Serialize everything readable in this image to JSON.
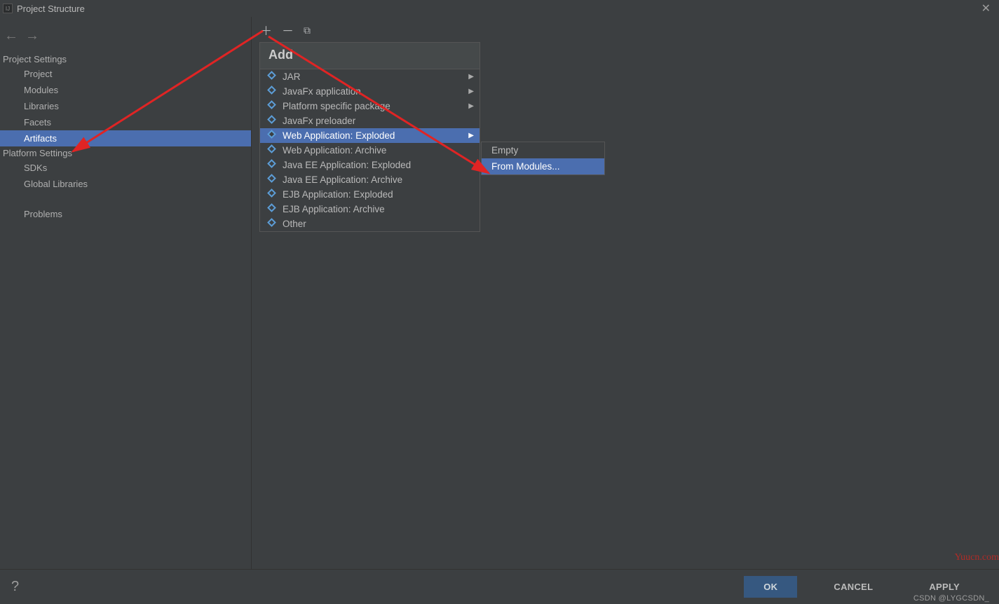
{
  "window": {
    "title": "Project Structure"
  },
  "sidebar": {
    "group1_label": "Project Settings",
    "items1": {
      "0": {
        "label": "Project"
      },
      "1": {
        "label": "Modules"
      },
      "2": {
        "label": "Libraries"
      },
      "3": {
        "label": "Facets"
      },
      "4": {
        "label": "Artifacts",
        "selected": true
      }
    },
    "group2_label": "Platform Settings",
    "items2": {
      "0": {
        "label": "SDKs"
      },
      "1": {
        "label": "Global Libraries"
      }
    },
    "extra": {
      "0": {
        "label": "Problems"
      }
    }
  },
  "popup_add": {
    "header": "Add",
    "items": {
      "0": {
        "label": "JAR",
        "has_sub": true
      },
      "1": {
        "label": "JavaFx application",
        "has_sub": true
      },
      "2": {
        "label": "Platform specific package",
        "has_sub": true
      },
      "3": {
        "label": "JavaFx preloader",
        "has_sub": false
      },
      "4": {
        "label": "Web Application: Exploded",
        "has_sub": true,
        "selected": true
      },
      "5": {
        "label": "Web Application: Archive",
        "has_sub": false
      },
      "6": {
        "label": "Java EE Application: Exploded",
        "has_sub": false
      },
      "7": {
        "label": "Java EE Application: Archive",
        "has_sub": false
      },
      "8": {
        "label": "EJB Application: Exploded",
        "has_sub": false
      },
      "9": {
        "label": "EJB Application: Archive",
        "has_sub": false
      },
      "10": {
        "label": "Other",
        "has_sub": false
      }
    }
  },
  "popup_sub": {
    "items": {
      "0": {
        "label": "Empty"
      },
      "1": {
        "label": "From Modules...",
        "selected": true
      }
    }
  },
  "footer": {
    "help": "?",
    "ok": "OK",
    "cancel": "CANCEL",
    "apply": "APPLY"
  },
  "watermarks": {
    "site": "Yuucn.com",
    "csdn": "CSDN @LYGCSDN_"
  }
}
